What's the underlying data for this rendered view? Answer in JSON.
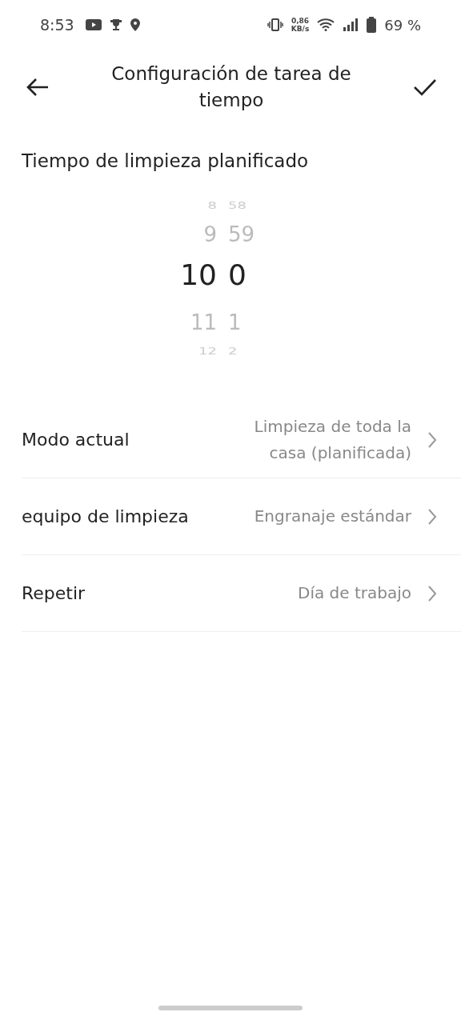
{
  "status_bar": {
    "time": "8:53",
    "speed_value": "0,86",
    "speed_unit": "KB/s",
    "battery": "69 %"
  },
  "header": {
    "title": "Configuración de tarea de tiempo"
  },
  "section_title": "Tiempo de limpieza planificado",
  "picker": {
    "hours": [
      {
        "label": "8",
        "selected": false
      },
      {
        "label": "9",
        "selected": false
      },
      {
        "label": "10",
        "selected": true
      },
      {
        "label": "11",
        "selected": false
      },
      {
        "label": "12",
        "selected": false
      }
    ],
    "minutes": [
      {
        "label": "58",
        "selected": false
      },
      {
        "label": "59",
        "selected": false
      },
      {
        "label": "0",
        "selected": true
      },
      {
        "label": "1",
        "selected": false
      },
      {
        "label": "2",
        "selected": false
      }
    ]
  },
  "settings": [
    {
      "label": "Modo actual",
      "value": "Limpieza de toda la casa (planificada)"
    },
    {
      "label": "equipo de limpieza",
      "value": "Engranaje estándar"
    },
    {
      "label": "Repetir",
      "value": "Día de trabajo"
    }
  ]
}
